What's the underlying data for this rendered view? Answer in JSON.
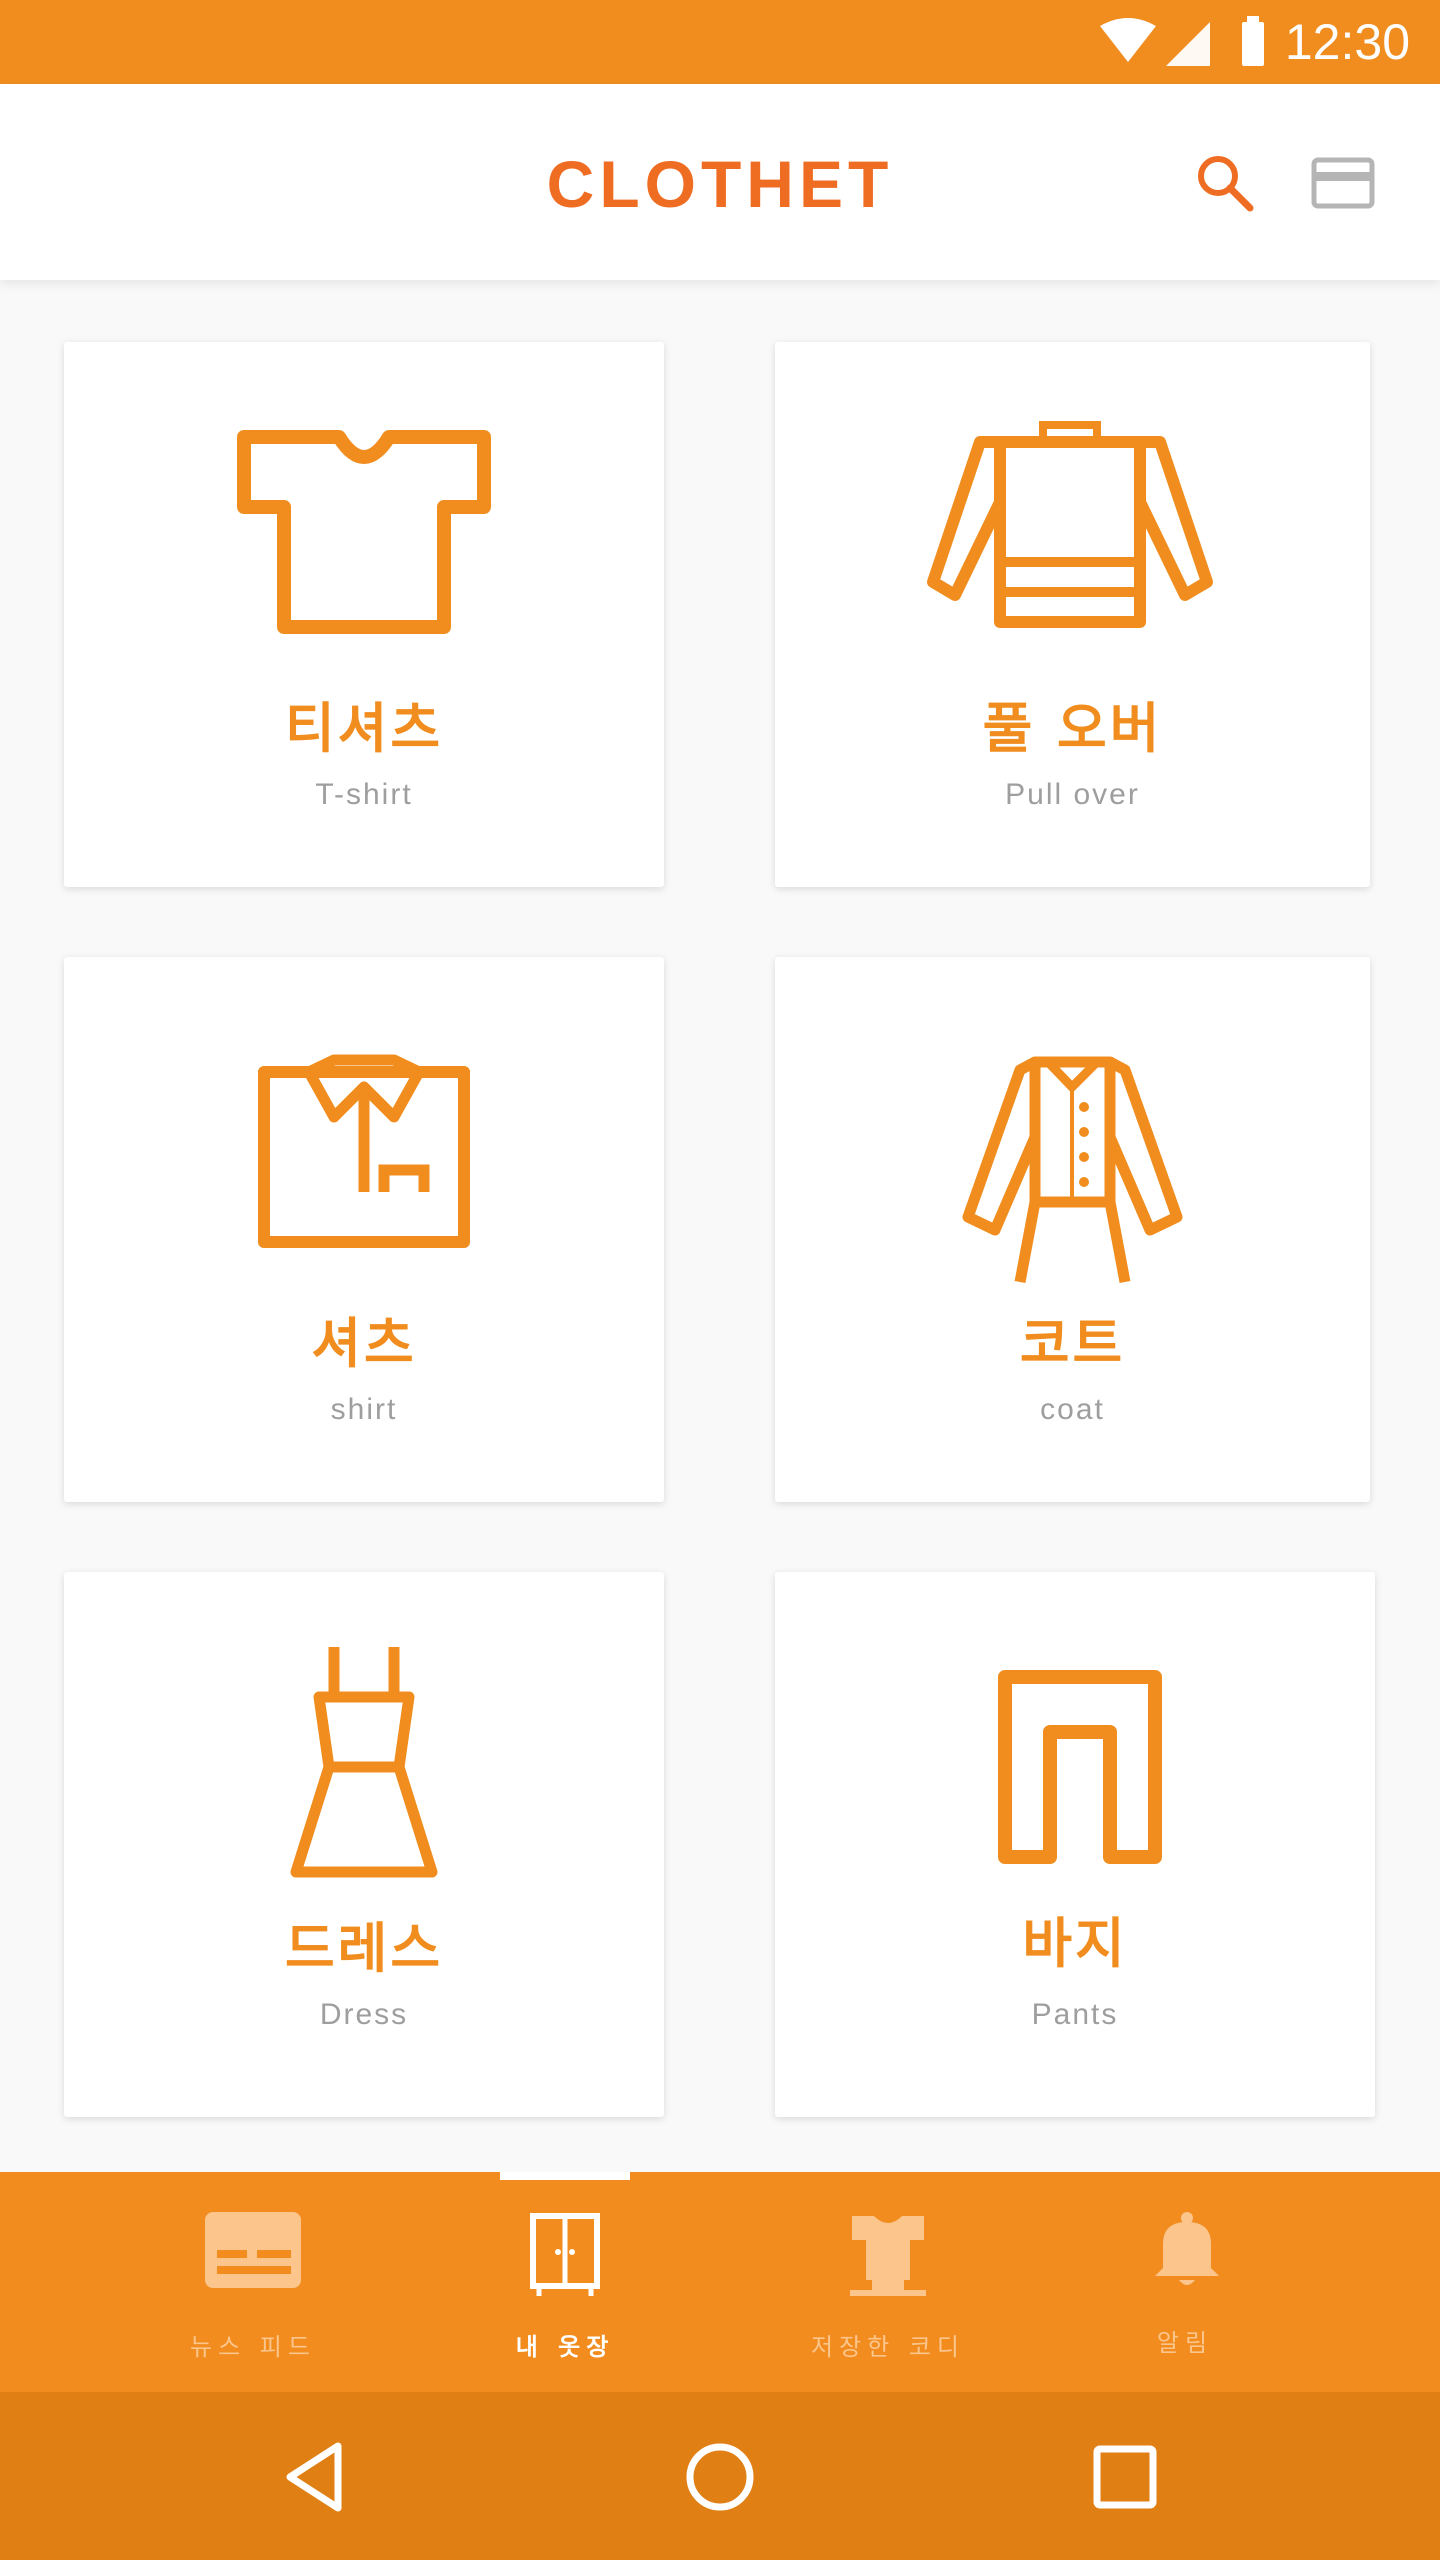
{
  "status_bar": {
    "time": "12:30"
  },
  "app_bar": {
    "brand": "CLOTHET"
  },
  "categories": [
    {
      "ko": "티셔츠",
      "en": "T-shirt",
      "icon": "tshirt-icon"
    },
    {
      "ko": "풀 오버",
      "en": "Pull over",
      "icon": "pullover-icon"
    },
    {
      "ko": "셔츠",
      "en": "shirt",
      "icon": "shirt-icon"
    },
    {
      "ko": "코트",
      "en": "coat",
      "icon": "coat-icon"
    },
    {
      "ko": "드레스",
      "en": "Dress",
      "icon": "dress-icon"
    },
    {
      "ko": "바지",
      "en": "Pants",
      "icon": "pants-icon"
    }
  ],
  "bottom_nav": [
    {
      "label": "뉴스 피드",
      "icon": "newsfeed-icon",
      "active": false
    },
    {
      "label": "내 옷장",
      "icon": "wardrobe-icon",
      "active": true
    },
    {
      "label": "저장한 코디",
      "icon": "saved-outfit-icon",
      "active": false
    },
    {
      "label": "알림",
      "icon": "bell-icon",
      "active": false
    }
  ],
  "colors": {
    "accent": "#f08d1e",
    "brand": "#ef6c23",
    "nav_bg": "#f28c1e",
    "sys_nav_bg": "#e07f14"
  }
}
